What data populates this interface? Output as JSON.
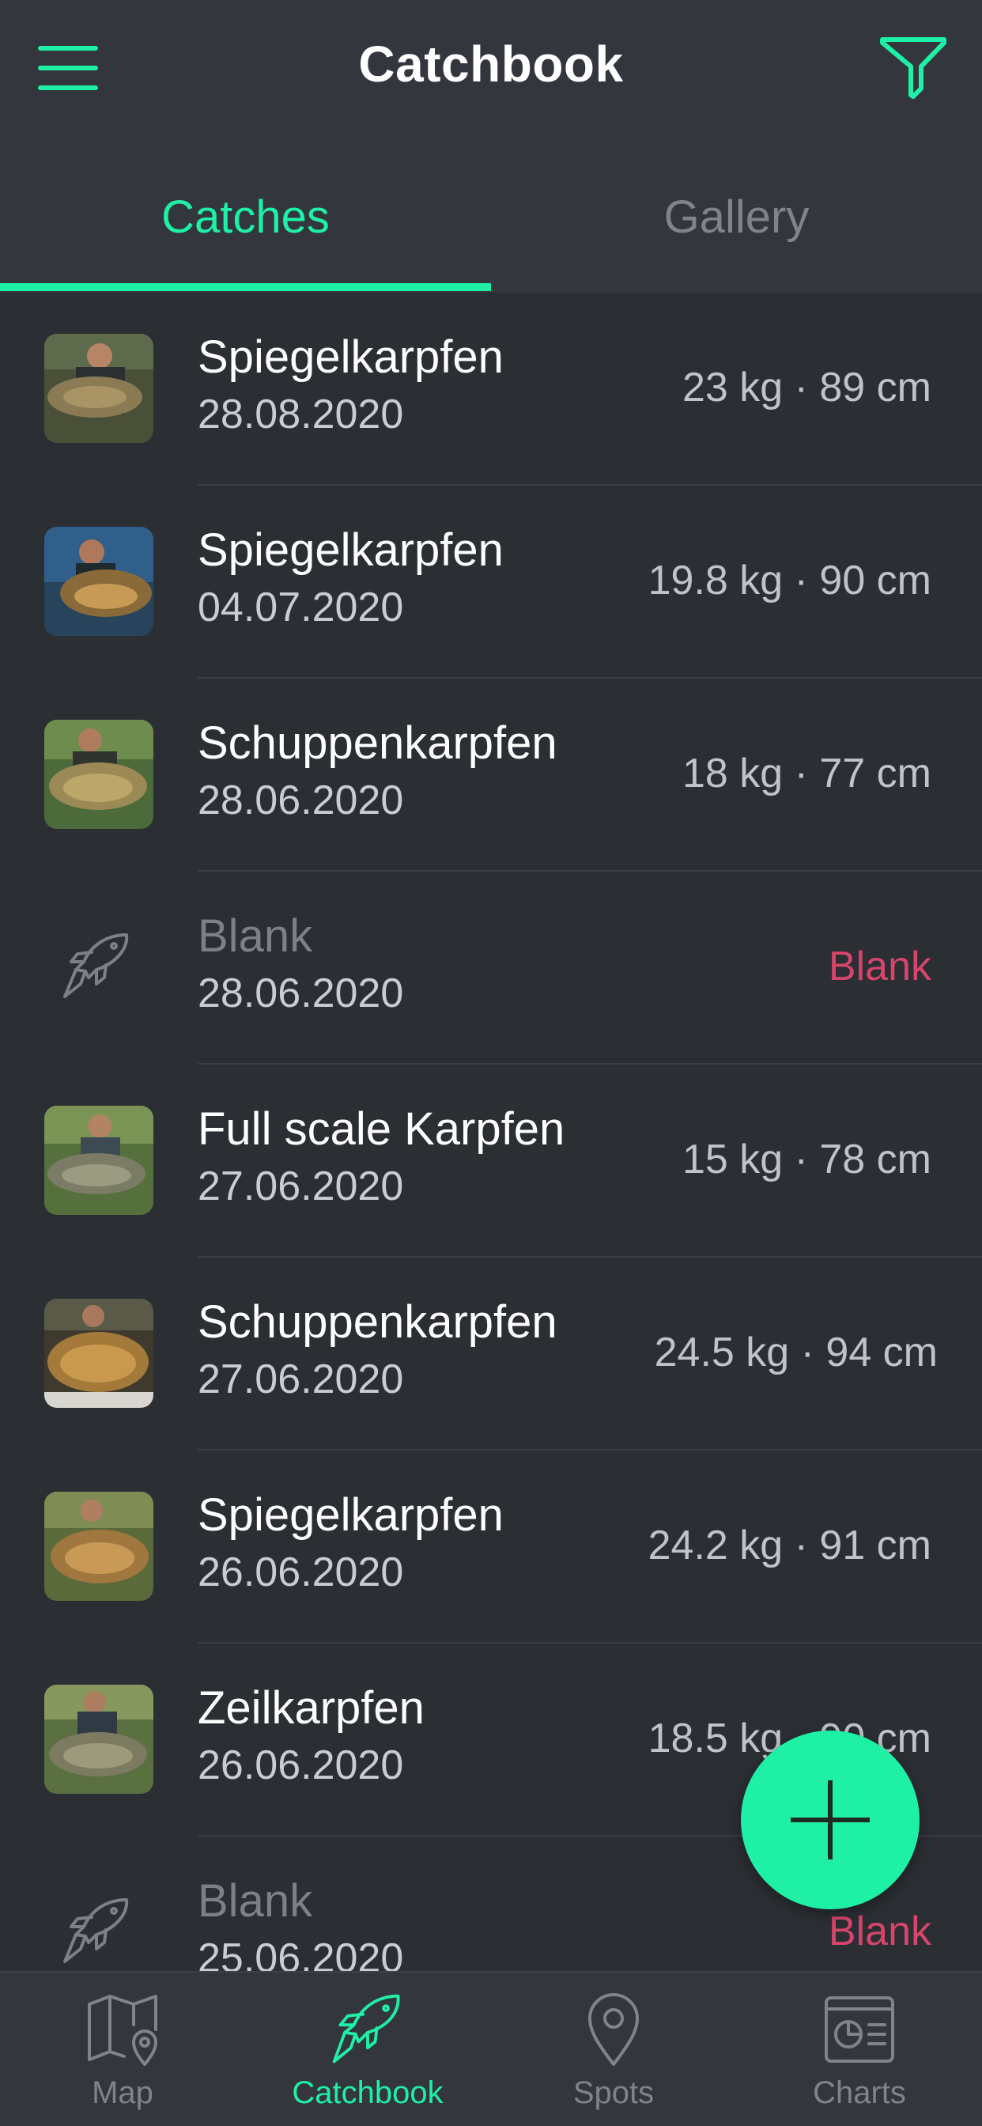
{
  "colors": {
    "accent": "#1ef0a5",
    "blank": "#d6456c",
    "background": "#2b2e33",
    "header": "#33363d"
  },
  "header": {
    "title": "Catchbook",
    "menu_icon": "hamburger-icon",
    "filter_icon": "filter-funnel-icon"
  },
  "tabs": [
    {
      "label": "Catches",
      "active": true
    },
    {
      "label": "Gallery",
      "active": false
    }
  ],
  "catches": [
    {
      "name": "Spiegelkarpfen",
      "date": "28.08.2020",
      "stats": "23 kg · 89 cm",
      "blank": false
    },
    {
      "name": "Spiegelkarpfen",
      "date": "04.07.2020",
      "stats": "19.8 kg · 90 cm",
      "blank": false
    },
    {
      "name": "Schuppenkarpfen",
      "date": "28.06.2020",
      "stats": "18 kg · 77 cm",
      "blank": false
    },
    {
      "name": "Blank",
      "date": "28.06.2020",
      "stats": "Blank",
      "blank": true
    },
    {
      "name": "Full scale Karpfen",
      "date": "27.06.2020",
      "stats": "15 kg · 78 cm",
      "blank": false
    },
    {
      "name": "Schuppenkarpfen",
      "date": "27.06.2020",
      "stats": "24.5 kg · 94 cm",
      "blank": false
    },
    {
      "name": "Spiegelkarpfen",
      "date": "26.06.2020",
      "stats": "24.2 kg · 91 cm",
      "blank": false
    },
    {
      "name": "Zeilkarpfen",
      "date": "26.06.2020",
      "stats": "18.5 kg · 90 cm",
      "blank": false
    },
    {
      "name": "Blank",
      "date": "25.06.2020",
      "stats": "Blank",
      "blank": true
    }
  ],
  "fab": {
    "icon": "plus-icon"
  },
  "bottom_nav": [
    {
      "label": "Map",
      "icon": "map-icon",
      "active": false
    },
    {
      "label": "Catchbook",
      "icon": "fish-icon",
      "active": true
    },
    {
      "label": "Spots",
      "icon": "location-pin-icon",
      "active": false
    },
    {
      "label": "Charts",
      "icon": "charts-icon",
      "active": false
    }
  ]
}
